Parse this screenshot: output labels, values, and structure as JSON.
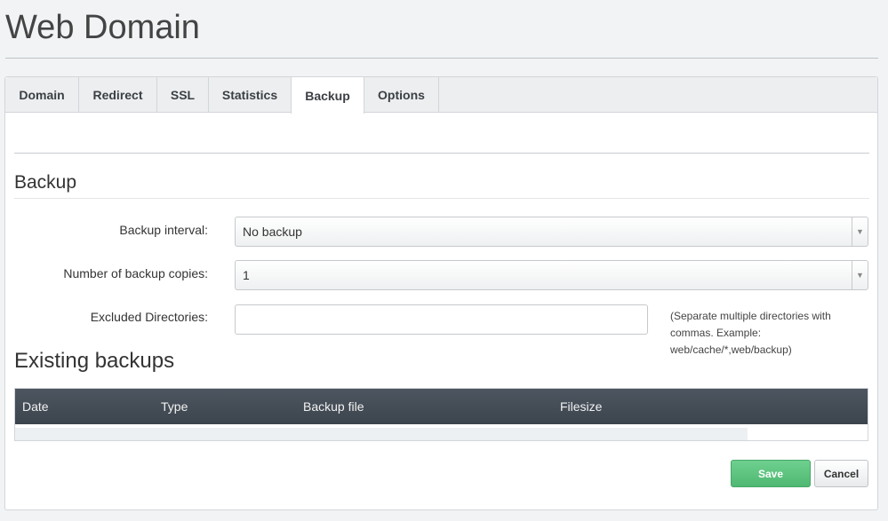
{
  "page": {
    "title": "Web Domain"
  },
  "tabs": [
    {
      "label": "Domain"
    },
    {
      "label": "Redirect"
    },
    {
      "label": "SSL"
    },
    {
      "label": "Statistics"
    },
    {
      "label": "Backup",
      "active": true
    },
    {
      "label": "Options"
    }
  ],
  "backup": {
    "heading": "Backup",
    "interval": {
      "label": "Backup interval:",
      "value": "No backup"
    },
    "copies": {
      "label": "Number of backup copies:",
      "value": "1"
    },
    "excluded": {
      "label": "Excluded Directories:",
      "value": "",
      "hint": "(Separate multiple directories with commas. Example: web/cache/*,web/backup)"
    }
  },
  "existing": {
    "heading": "Existing backups",
    "columns": [
      "Date",
      "Type",
      "Backup file",
      "Filesize"
    ],
    "rows": []
  },
  "buttons": {
    "save": "Save",
    "cancel": "Cancel"
  },
  "colors": {
    "save_green": "#5cc27d",
    "table_header": "#434b54"
  }
}
